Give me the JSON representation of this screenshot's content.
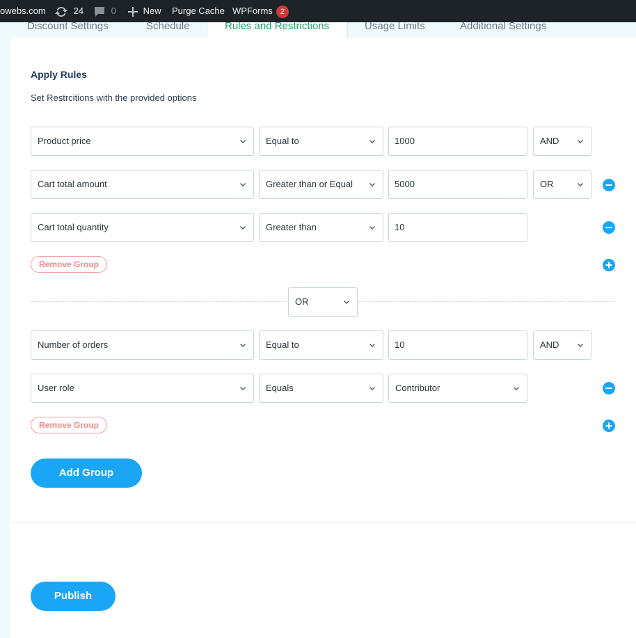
{
  "adminbar": {
    "site": "owebs.com",
    "updates_count": "24",
    "comments_count": "0",
    "new_label": "New",
    "purge_label": "Purge Cache",
    "wpforms_label": "WPForms",
    "wpforms_badge": "2"
  },
  "tabs": [
    "Discount Settings",
    "Schedule",
    "Rules and Restrictions",
    "Usage Limits",
    "Additional Settings"
  ],
  "active_tab": "Rules and Restrictions",
  "section": {
    "title": "Apply Rules",
    "subtitle": "Set Restrcitions with the provided options"
  },
  "groups": [
    {
      "rules": [
        {
          "field": "Product price",
          "operator": "Equal to",
          "value": "1000",
          "connector": "AND"
        },
        {
          "field": "Cart total amount",
          "operator": "Greater than or Equal",
          "value": "5000",
          "connector": "OR"
        },
        {
          "field": "Cart total quantity",
          "operator": "Greater than",
          "value": "10"
        }
      ],
      "remove_label": "Remove Group"
    },
    {
      "rules": [
        {
          "field": "Number of orders",
          "operator": "Equal to",
          "value": "10",
          "connector": "AND"
        },
        {
          "field": "User role",
          "operator": "Equals",
          "value": "Contributor"
        }
      ],
      "remove_label": "Remove Group"
    }
  ],
  "group_connector": "OR",
  "add_group_label": "Add Group",
  "publish_label": "Publish",
  "colors": {
    "accent": "#1ba6f5",
    "active_tab": "#22a06b",
    "danger": "#f08a8a",
    "adminbar": "#1d2327"
  }
}
